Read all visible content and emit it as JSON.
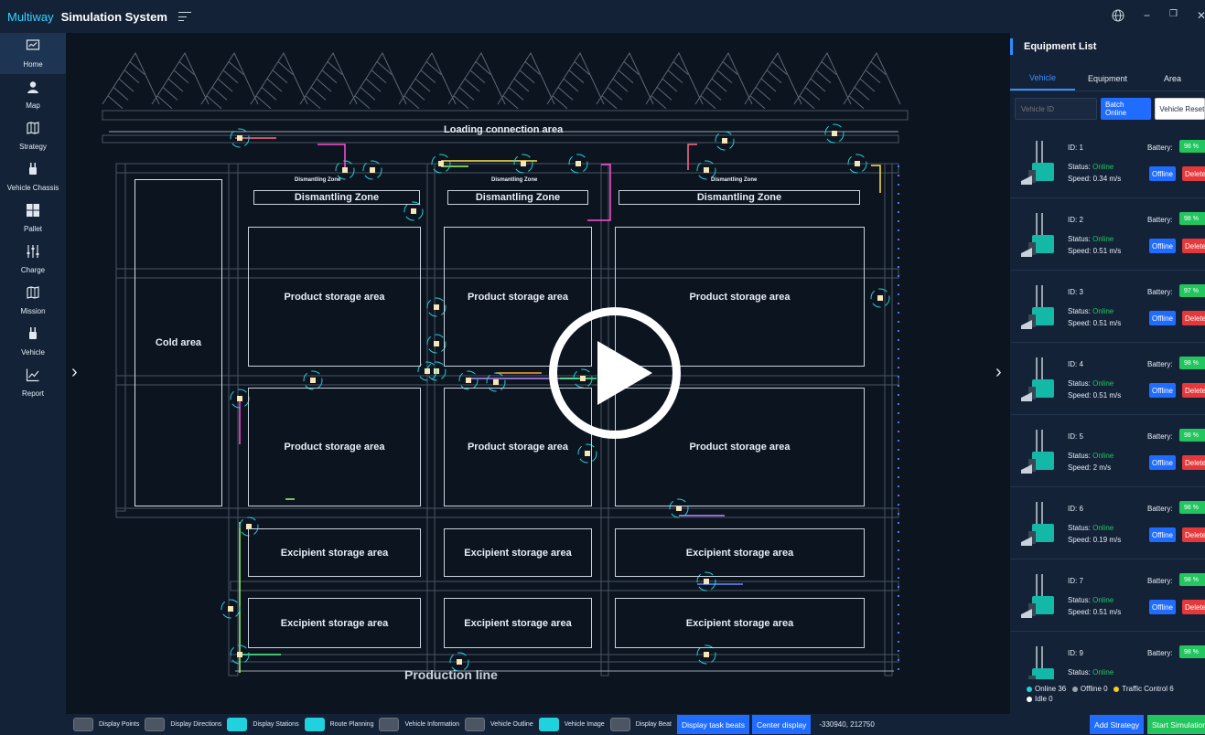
{
  "titlebar": {
    "brand": "Multiway",
    "app_name": "Simulation System"
  },
  "nav": [
    {
      "label": "Home",
      "icon": "home-chart-icon"
    },
    {
      "label": "Map",
      "icon": "map-pin-icon"
    },
    {
      "label": "Strategy",
      "icon": "strategy-map-icon"
    },
    {
      "label": "Vehicle Chassis",
      "icon": "vehicle-chassis-icon"
    },
    {
      "label": "Pallet",
      "icon": "pallet-icon"
    },
    {
      "label": "Charge",
      "icon": "charge-sliders-icon"
    },
    {
      "label": "Mission",
      "icon": "mission-map-icon"
    },
    {
      "label": "Vehicle",
      "icon": "vehicle-icon"
    },
    {
      "label": "Report",
      "icon": "report-chart-icon"
    }
  ],
  "map": {
    "loading_area": "Loading connection area",
    "dismantling_small": "Dismantling Zone",
    "dismantling": "Dismantling Zone",
    "product": "Product storage area",
    "cold": "Cold  area",
    "excipient": "Excipient storage area",
    "production_line": "Production line"
  },
  "panel": {
    "title": "Equipment List",
    "tabs": [
      "Vehicle",
      "Equipment",
      "Area"
    ],
    "vehicle_id_placeholder": "Vehicle ID",
    "batch_online": "Batch Online",
    "vehicle_reset": "Vehicle Reset",
    "id_prefix": "ID: ",
    "battery_label": "Battery:",
    "status_label": "Status: ",
    "speed_label": "Speed: ",
    "offline_btn": "Offline",
    "delete_btn": "Delete",
    "vehicles": [
      {
        "id": "1",
        "battery": "98 %",
        "status": "Online",
        "speed": "0.34 m/s"
      },
      {
        "id": "2",
        "battery": "98 %",
        "status": "Online",
        "speed": "0.51 m/s"
      },
      {
        "id": "3",
        "battery": "97 %",
        "status": "Online",
        "speed": "0.51 m/s"
      },
      {
        "id": "4",
        "battery": "98 %",
        "status": "Online",
        "speed": "0.51 m/s"
      },
      {
        "id": "5",
        "battery": "98 %",
        "status": "Online",
        "speed": "2 m/s"
      },
      {
        "id": "6",
        "battery": "98 %",
        "status": "Online",
        "speed": "0.19 m/s"
      },
      {
        "id": "7",
        "battery": "98 %",
        "status": "Online",
        "speed": "0.51 m/s"
      },
      {
        "id": "9",
        "battery": "98 %",
        "status": "Online",
        "speed": ""
      }
    ],
    "legend": {
      "online": "Online 36",
      "offline": "Offline 0",
      "traffic": "Traffic Control 6",
      "idle": "Idle 0"
    },
    "colors": {
      "online": "#22c55e",
      "offline": "#9ca3af",
      "traffic": "#facc15",
      "idle": "#ffffff"
    }
  },
  "bottom": {
    "toggles": [
      {
        "label": "Display Points",
        "on": false
      },
      {
        "label": "Display Directions",
        "on": false
      },
      {
        "label": "Display Stations",
        "on": true
      },
      {
        "label": "Route Planning",
        "on": true
      },
      {
        "label": "Vehicle Information",
        "on": false
      },
      {
        "label": "Vehicle Outline",
        "on": false
      },
      {
        "label": "Vehicle Image",
        "on": true
      },
      {
        "label": "Display Beat",
        "on": false
      }
    ],
    "task_beats": "Display task beats",
    "center_display": "Center display",
    "coords": "-330940, 212750",
    "add_strategy": "Add Strategy",
    "start_simulation": "Start Simulation"
  }
}
